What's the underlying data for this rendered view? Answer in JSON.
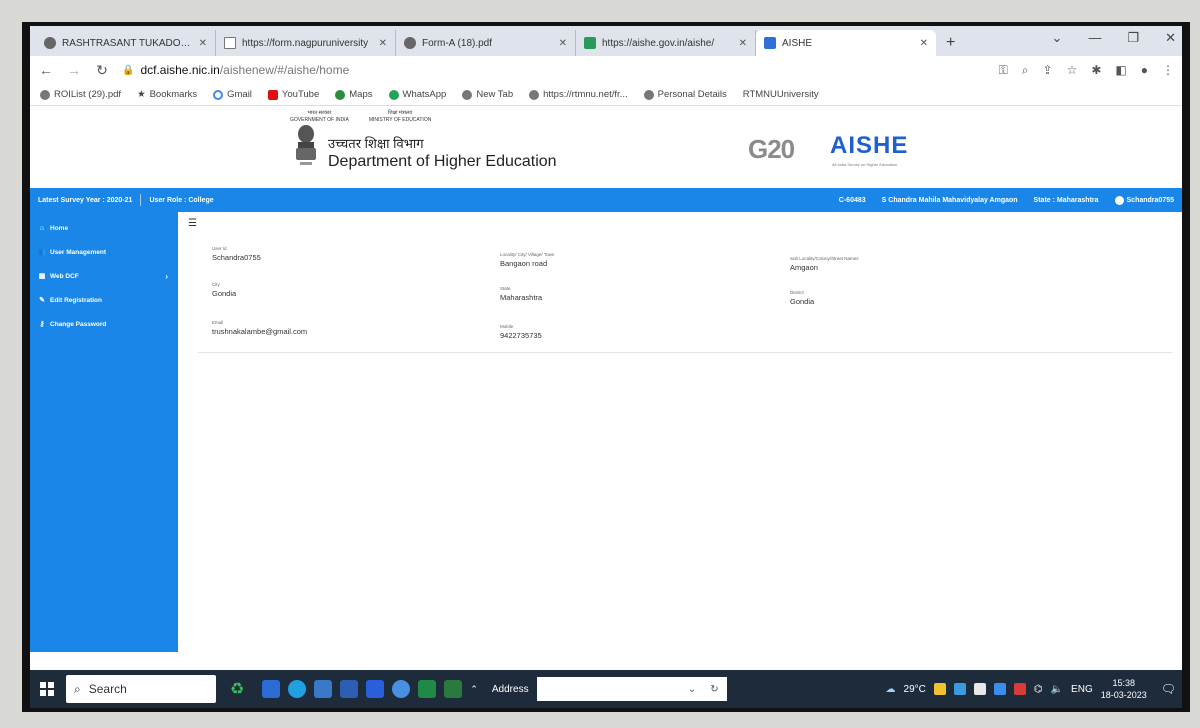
{
  "browser": {
    "tabs": [
      {
        "title": "RASHTRASANT TUKADOJI M",
        "icon": "globe-icon",
        "active": false
      },
      {
        "title": "https://form.nagpuruniversity",
        "icon": "doc-icon",
        "active": false
      },
      {
        "title": "Form-A (18).pdf",
        "icon": "globe-icon",
        "active": false
      },
      {
        "title": "https://aishe.gov.in/aishe/",
        "icon": "aishe-gov-icon",
        "active": false
      },
      {
        "title": "AISHE",
        "icon": "aishe-icon",
        "active": true
      }
    ],
    "url_host": "dcf.aishe.nic.in",
    "url_path": "/aishenew/#/aishe/home",
    "bookmarks": [
      {
        "label": "ROIList (29).pdf",
        "icon": "globe-icon"
      },
      {
        "label": "Bookmarks",
        "icon": "star-icon"
      },
      {
        "label": "Gmail",
        "icon": "google-icon"
      },
      {
        "label": "YouTube",
        "icon": "youtube-icon"
      },
      {
        "label": "Maps",
        "icon": "maps-icon"
      },
      {
        "label": "WhatsApp",
        "icon": "whatsapp-icon"
      },
      {
        "label": "New Tab",
        "icon": "globe-icon"
      },
      {
        "label": "https://rtmnu.net/fr...",
        "icon": "globe-icon"
      },
      {
        "label": "Personal Details",
        "icon": "globe-icon"
      },
      {
        "label": "RTMNUUniversity",
        "icon": "globe-icon"
      }
    ]
  },
  "site": {
    "goi_hindi": "भारत सरकार",
    "goi_english": "GOVERNMENT OF INDIA",
    "moe_hindi": "शिक्षा मंत्रालय",
    "moe_english": "MINISTRY OF EDUCATION",
    "dept_hindi": "उच्चतर शिक्षा विभाग",
    "dept_english": "Department of Higher Education",
    "g20_text": "G20",
    "aishe_text": "AISHE",
    "aishe_sub": "All India Survey on Higher Education"
  },
  "infobar": {
    "survey_year": "Latest Survey Year : 2020-21",
    "user_role": "User Role : College",
    "college_code": "C-60483",
    "college_name": "S Chandra Mahila Mahavidyalay Amgaon",
    "state": "State : Maharashtra",
    "username": "Schandra0755"
  },
  "sidebar": {
    "items": [
      {
        "label": "Home",
        "icon": "home-icon"
      },
      {
        "label": "User Management",
        "icon": "users-icon"
      },
      {
        "label": "Web DCF",
        "icon": "grid-icon"
      },
      {
        "label": "Edit Registration",
        "icon": "edit-icon"
      },
      {
        "label": "Change Password",
        "icon": "key-icon"
      }
    ]
  },
  "profile": {
    "user_id_label": "User Id",
    "user_id": "Schandra0755",
    "locality_label": "Locality/ City/ Village/ Town",
    "locality": "Bangaon road",
    "sub_locality_label": "Sub Locality/Colony/Street Names",
    "sub_locality": "Amgaon",
    "city_label": "City",
    "city": "Gondia",
    "state_label": "State",
    "state": "Maharashtra",
    "district_label": "District",
    "district": "Gondia",
    "email_label": "Email",
    "email": "trushnakalambe@gmail.com",
    "mobile_label": "Mobile",
    "mobile": "9422735735"
  },
  "taskbar": {
    "search_label": "Search",
    "address_label": "Address",
    "temperature": "29°C",
    "language": "ENG",
    "time": "15:38",
    "date": "18-03-2023"
  }
}
